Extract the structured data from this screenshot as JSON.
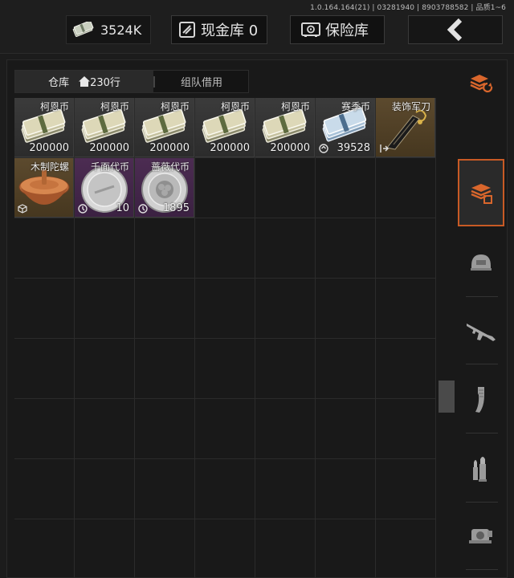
{
  "version_text": "1.0.164.164(21) | 03281940 | 8903788582 | 品质1~6",
  "topbar": {
    "money": "3524K",
    "cash_vault": "现金库 0",
    "safe": "保险库"
  },
  "tabs": {
    "storage": "仓库",
    "rows": "230行",
    "borrow": "组队借用"
  },
  "items": [
    {
      "name": "柯恩币",
      "qty": "200000"
    },
    {
      "name": "柯恩币",
      "qty": "200000"
    },
    {
      "name": "柯恩币",
      "qty": "200000"
    },
    {
      "name": "柯恩币",
      "qty": "200000"
    },
    {
      "name": "柯恩币",
      "qty": "200000"
    },
    {
      "name": "赛季币",
      "qty": "39528"
    },
    {
      "name": "装饰军刀",
      "qty": ""
    },
    {
      "name": "木制陀螺",
      "qty": ""
    },
    {
      "name": "千面代币",
      "qty": "10"
    },
    {
      "name": "蔷薇代币",
      "qty": "1895"
    }
  ],
  "sidebar": [
    "sort-icon",
    "storage-icon",
    "helmet-icon",
    "rifle-icon",
    "magazine-icon",
    "ammo-icon",
    "scope-icon"
  ],
  "colors": {
    "accent": "#c85a25",
    "item_gray": "#3b3b3b",
    "item_gold": "#5c4a2e",
    "item_purple": "#4c2c52"
  }
}
